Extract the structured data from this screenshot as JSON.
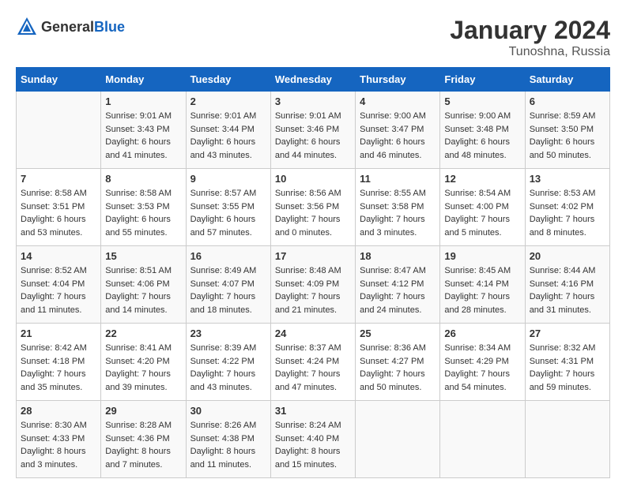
{
  "header": {
    "logo_general": "General",
    "logo_blue": "Blue",
    "month_title": "January 2024",
    "location": "Tunoshna, Russia"
  },
  "days_of_week": [
    "Sunday",
    "Monday",
    "Tuesday",
    "Wednesday",
    "Thursday",
    "Friday",
    "Saturday"
  ],
  "weeks": [
    [
      {
        "day": "",
        "sunrise": "",
        "sunset": "",
        "daylight": ""
      },
      {
        "day": "1",
        "sunrise": "Sunrise: 9:01 AM",
        "sunset": "Sunset: 3:43 PM",
        "daylight": "Daylight: 6 hours and 41 minutes."
      },
      {
        "day": "2",
        "sunrise": "Sunrise: 9:01 AM",
        "sunset": "Sunset: 3:44 PM",
        "daylight": "Daylight: 6 hours and 43 minutes."
      },
      {
        "day": "3",
        "sunrise": "Sunrise: 9:01 AM",
        "sunset": "Sunset: 3:46 PM",
        "daylight": "Daylight: 6 hours and 44 minutes."
      },
      {
        "day": "4",
        "sunrise": "Sunrise: 9:00 AM",
        "sunset": "Sunset: 3:47 PM",
        "daylight": "Daylight: 6 hours and 46 minutes."
      },
      {
        "day": "5",
        "sunrise": "Sunrise: 9:00 AM",
        "sunset": "Sunset: 3:48 PM",
        "daylight": "Daylight: 6 hours and 48 minutes."
      },
      {
        "day": "6",
        "sunrise": "Sunrise: 8:59 AM",
        "sunset": "Sunset: 3:50 PM",
        "daylight": "Daylight: 6 hours and 50 minutes."
      }
    ],
    [
      {
        "day": "7",
        "sunrise": "Sunrise: 8:58 AM",
        "sunset": "Sunset: 3:51 PM",
        "daylight": "Daylight: 6 hours and 53 minutes."
      },
      {
        "day": "8",
        "sunrise": "Sunrise: 8:58 AM",
        "sunset": "Sunset: 3:53 PM",
        "daylight": "Daylight: 6 hours and 55 minutes."
      },
      {
        "day": "9",
        "sunrise": "Sunrise: 8:57 AM",
        "sunset": "Sunset: 3:55 PM",
        "daylight": "Daylight: 6 hours and 57 minutes."
      },
      {
        "day": "10",
        "sunrise": "Sunrise: 8:56 AM",
        "sunset": "Sunset: 3:56 PM",
        "daylight": "Daylight: 7 hours and 0 minutes."
      },
      {
        "day": "11",
        "sunrise": "Sunrise: 8:55 AM",
        "sunset": "Sunset: 3:58 PM",
        "daylight": "Daylight: 7 hours and 3 minutes."
      },
      {
        "day": "12",
        "sunrise": "Sunrise: 8:54 AM",
        "sunset": "Sunset: 4:00 PM",
        "daylight": "Daylight: 7 hours and 5 minutes."
      },
      {
        "day": "13",
        "sunrise": "Sunrise: 8:53 AM",
        "sunset": "Sunset: 4:02 PM",
        "daylight": "Daylight: 7 hours and 8 minutes."
      }
    ],
    [
      {
        "day": "14",
        "sunrise": "Sunrise: 8:52 AM",
        "sunset": "Sunset: 4:04 PM",
        "daylight": "Daylight: 7 hours and 11 minutes."
      },
      {
        "day": "15",
        "sunrise": "Sunrise: 8:51 AM",
        "sunset": "Sunset: 4:06 PM",
        "daylight": "Daylight: 7 hours and 14 minutes."
      },
      {
        "day": "16",
        "sunrise": "Sunrise: 8:49 AM",
        "sunset": "Sunset: 4:07 PM",
        "daylight": "Daylight: 7 hours and 18 minutes."
      },
      {
        "day": "17",
        "sunrise": "Sunrise: 8:48 AM",
        "sunset": "Sunset: 4:09 PM",
        "daylight": "Daylight: 7 hours and 21 minutes."
      },
      {
        "day": "18",
        "sunrise": "Sunrise: 8:47 AM",
        "sunset": "Sunset: 4:12 PM",
        "daylight": "Daylight: 7 hours and 24 minutes."
      },
      {
        "day": "19",
        "sunrise": "Sunrise: 8:45 AM",
        "sunset": "Sunset: 4:14 PM",
        "daylight": "Daylight: 7 hours and 28 minutes."
      },
      {
        "day": "20",
        "sunrise": "Sunrise: 8:44 AM",
        "sunset": "Sunset: 4:16 PM",
        "daylight": "Daylight: 7 hours and 31 minutes."
      }
    ],
    [
      {
        "day": "21",
        "sunrise": "Sunrise: 8:42 AM",
        "sunset": "Sunset: 4:18 PM",
        "daylight": "Daylight: 7 hours and 35 minutes."
      },
      {
        "day": "22",
        "sunrise": "Sunrise: 8:41 AM",
        "sunset": "Sunset: 4:20 PM",
        "daylight": "Daylight: 7 hours and 39 minutes."
      },
      {
        "day": "23",
        "sunrise": "Sunrise: 8:39 AM",
        "sunset": "Sunset: 4:22 PM",
        "daylight": "Daylight: 7 hours and 43 minutes."
      },
      {
        "day": "24",
        "sunrise": "Sunrise: 8:37 AM",
        "sunset": "Sunset: 4:24 PM",
        "daylight": "Daylight: 7 hours and 47 minutes."
      },
      {
        "day": "25",
        "sunrise": "Sunrise: 8:36 AM",
        "sunset": "Sunset: 4:27 PM",
        "daylight": "Daylight: 7 hours and 50 minutes."
      },
      {
        "day": "26",
        "sunrise": "Sunrise: 8:34 AM",
        "sunset": "Sunset: 4:29 PM",
        "daylight": "Daylight: 7 hours and 54 minutes."
      },
      {
        "day": "27",
        "sunrise": "Sunrise: 8:32 AM",
        "sunset": "Sunset: 4:31 PM",
        "daylight": "Daylight: 7 hours and 59 minutes."
      }
    ],
    [
      {
        "day": "28",
        "sunrise": "Sunrise: 8:30 AM",
        "sunset": "Sunset: 4:33 PM",
        "daylight": "Daylight: 8 hours and 3 minutes."
      },
      {
        "day": "29",
        "sunrise": "Sunrise: 8:28 AM",
        "sunset": "Sunset: 4:36 PM",
        "daylight": "Daylight: 8 hours and 7 minutes."
      },
      {
        "day": "30",
        "sunrise": "Sunrise: 8:26 AM",
        "sunset": "Sunset: 4:38 PM",
        "daylight": "Daylight: 8 hours and 11 minutes."
      },
      {
        "day": "31",
        "sunrise": "Sunrise: 8:24 AM",
        "sunset": "Sunset: 4:40 PM",
        "daylight": "Daylight: 8 hours and 15 minutes."
      },
      {
        "day": "",
        "sunrise": "",
        "sunset": "",
        "daylight": ""
      },
      {
        "day": "",
        "sunrise": "",
        "sunset": "",
        "daylight": ""
      },
      {
        "day": "",
        "sunrise": "",
        "sunset": "",
        "daylight": ""
      }
    ]
  ]
}
